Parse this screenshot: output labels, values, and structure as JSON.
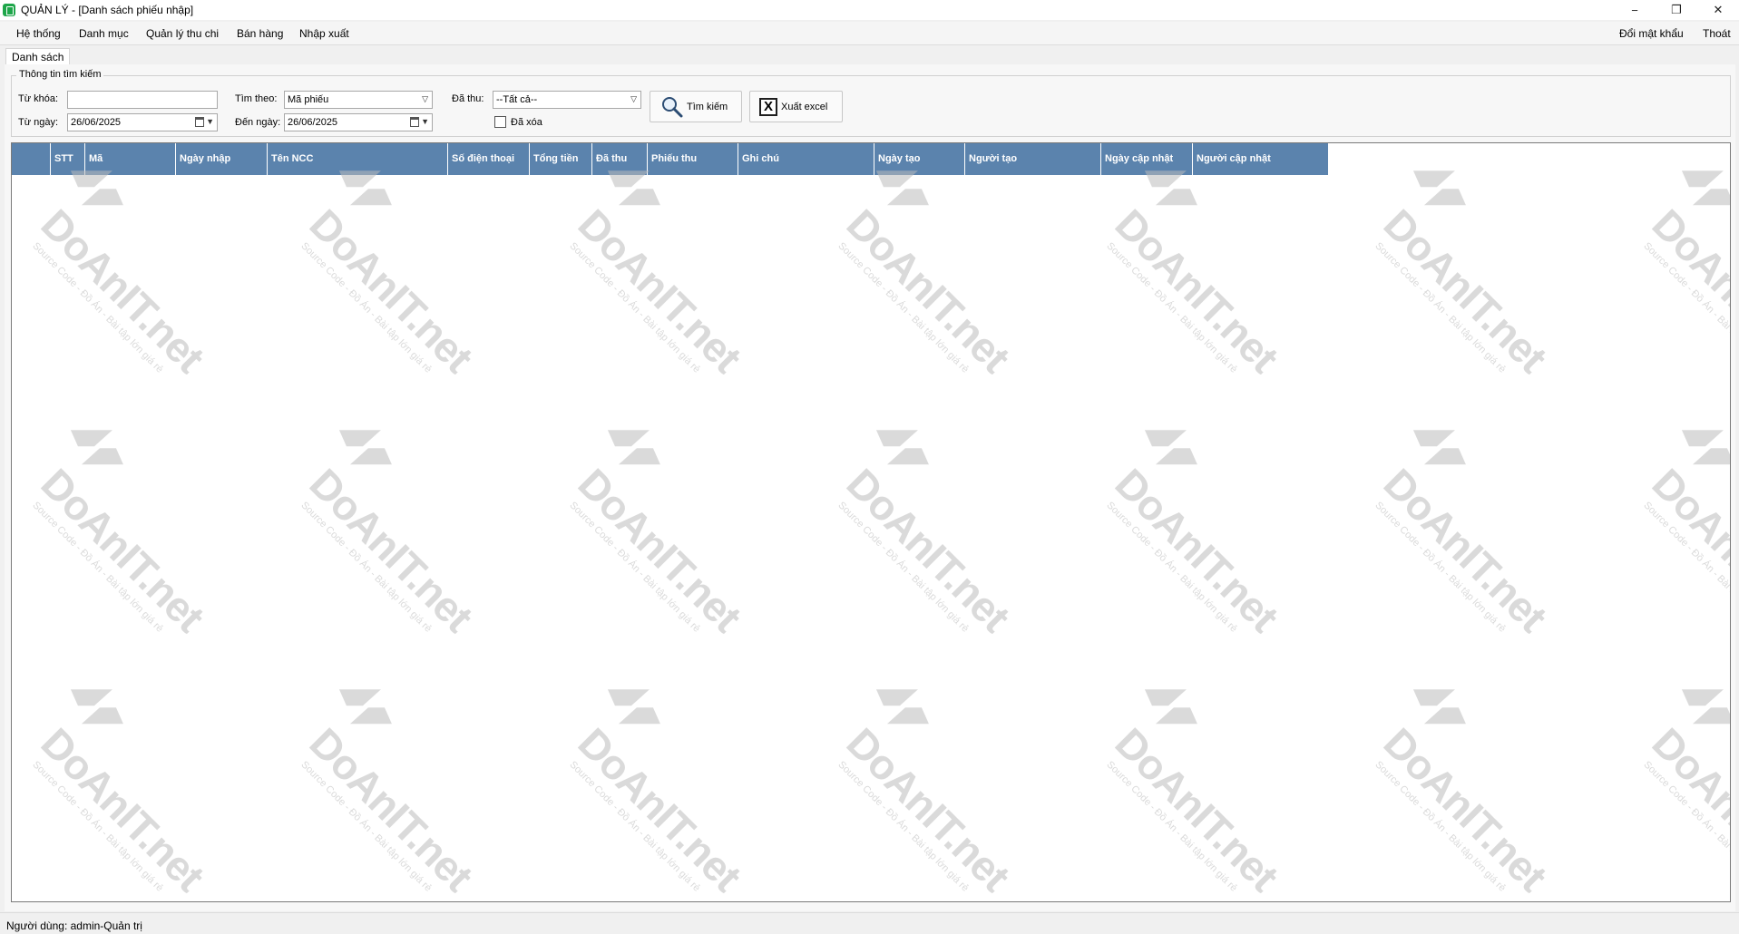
{
  "window": {
    "title": "QUẢN LÝ - [Danh sách phiếu nhập]",
    "controls": {
      "minimize": "−",
      "restore": "❐",
      "close": "✕"
    }
  },
  "menu": {
    "items": [
      "Hệ thống",
      "Danh mục",
      "Quản lý thu chi",
      "Bán hàng",
      "Nhập xuất"
    ],
    "right_items": [
      "Đổi mật khẩu",
      "Thoát"
    ]
  },
  "tab": {
    "label": "Danh sách"
  },
  "search": {
    "group_title": "Thông tin tìm kiếm",
    "keyword_label": "Từ khóa:",
    "keyword_value": "",
    "search_by_label": "Tìm theo:",
    "search_by_value": "Mã phiếu",
    "paid_label": "Đã thu:",
    "paid_value": "--Tất cả--",
    "from_date_label": "Từ ngày:",
    "from_date_value": "26/06/2025",
    "to_date_label": "Đến ngày:",
    "to_date_value": "26/06/2025",
    "deleted_label": "Đã xóa",
    "deleted_checked": false,
    "search_button": "Tìm kiếm",
    "export_button": "Xuất excel"
  },
  "grid": {
    "columns": [
      "",
      "STT",
      "Mã",
      "Ngày nhập",
      "Tên NCC",
      "Số điện thoại",
      "Tổng tiền",
      "Đã thu",
      "Phiếu thu",
      "Ghi chú",
      "Ngày tạo",
      "Người tạo",
      "Ngày cập nhật",
      "Người cập nhật"
    ],
    "rows": []
  },
  "status": {
    "text": "Người dùng: admin-Quản trị"
  },
  "watermark": {
    "main": "DoAnIT.net",
    "sub": "Source Code - Đồ Án - Bài tập lớn giá rẻ"
  },
  "colors": {
    "grid_header": "#5b83ad",
    "app_icon": "#1ea64a"
  }
}
